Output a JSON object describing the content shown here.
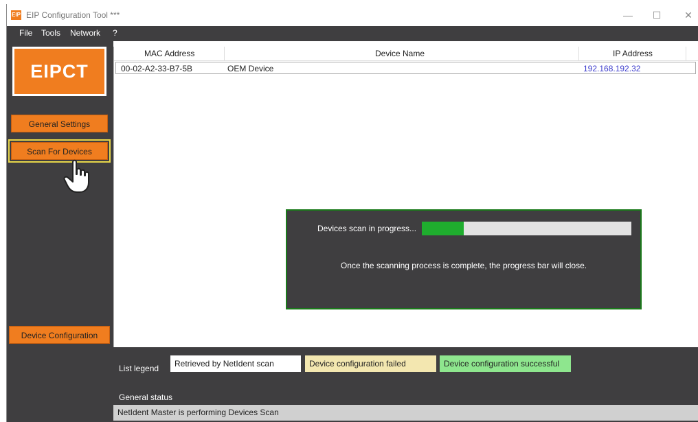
{
  "window": {
    "title": "EIP Configuration Tool ***",
    "app_icon": "EIP",
    "controls": {
      "minimize": "—",
      "maximize": "☐",
      "close": "✕"
    }
  },
  "menu": [
    "File",
    "Tools",
    "Network",
    "?"
  ],
  "sidebar": {
    "logo": "EIPCT",
    "buttons": {
      "general_settings": "General Settings",
      "scan_for_devices": "Scan For Devices",
      "device_configuration": "Device Configuration"
    },
    "selected": "scan_for_devices"
  },
  "table": {
    "headers": {
      "mac": "MAC Address",
      "name": "Device Name",
      "ip": "IP Address"
    },
    "rows": [
      {
        "mac": "00-02-A2-33-B7-5B",
        "name": "OEM Device",
        "ip": "192.168.192.32"
      }
    ]
  },
  "scan_dialog": {
    "label": "Devices scan in progress...",
    "progress": 0.2,
    "message": "Once the scanning process is complete, the progress bar will close."
  },
  "legend": {
    "label": "List legend",
    "items": [
      {
        "text": "Retrieved by NetIdent scan",
        "color": "#ffffff"
      },
      {
        "text": "Device configuration failed",
        "color": "#f3e7b0"
      },
      {
        "text": "Device configuration successful",
        "color": "#8ee68e"
      }
    ]
  },
  "status": {
    "label": "General status",
    "text": "NetIdent Master is performing Devices Scan"
  },
  "colors": {
    "accent": "#f07d1f",
    "panel": "#3f3e40",
    "progress": "#1fad2e",
    "dialog_border": "#1a7a1a"
  },
  "icons": {
    "cursor": "hand-pointer-icon"
  }
}
